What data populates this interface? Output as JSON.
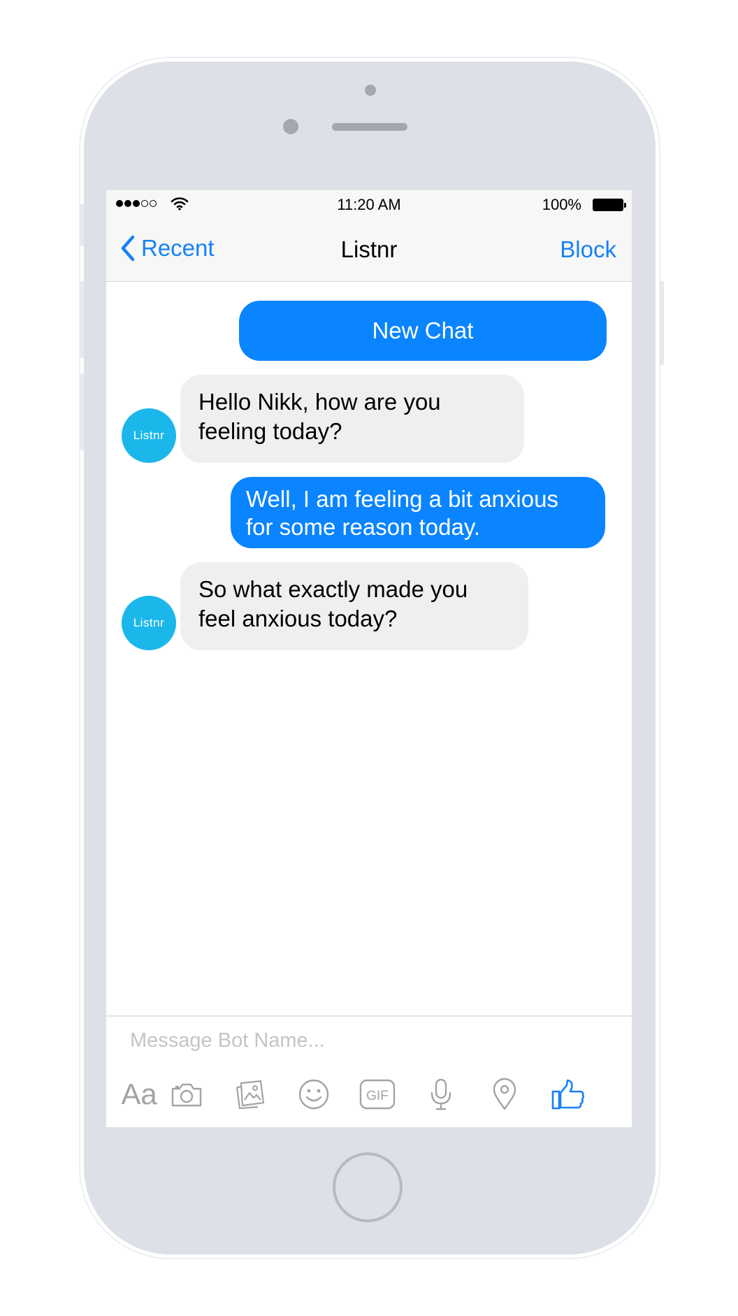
{
  "status_bar": {
    "time": "11:20 AM",
    "battery": "100%",
    "signal_bars_filled": 3,
    "signal_bars_total": 5
  },
  "nav": {
    "back_label": "Recent",
    "title": "Listnr",
    "block_label": "Block"
  },
  "chat": {
    "new_chat_label": "New Chat",
    "avatar_label": "Listnr",
    "messages": [
      {
        "sender": "bot",
        "text": "Hello Nikk, how are you feeling today?"
      },
      {
        "sender": "user",
        "text": "Well, I am feeling a bit anxious for some reason today."
      },
      {
        "sender": "bot",
        "text": "So what exactly made you feel anxious today?"
      }
    ]
  },
  "composer": {
    "placeholder": "Message Bot Name...",
    "tools": [
      {
        "name": "text-format",
        "label": "Aa"
      },
      {
        "name": "camera-icon"
      },
      {
        "name": "gallery-icon"
      },
      {
        "name": "emoji-icon"
      },
      {
        "name": "gif-icon",
        "label": "GIF"
      },
      {
        "name": "microphone-icon"
      },
      {
        "name": "location-icon"
      },
      {
        "name": "thumbs-up-icon"
      }
    ]
  },
  "colors": {
    "accent": "#1782f3",
    "user_bubble": "#0a84ff",
    "bot_bubble": "#efefef",
    "avatar": "#1cb7ea",
    "phone_body": "#dde0e7",
    "toolbar_icon": "#a3a3a8",
    "like_icon": "#1782f3"
  }
}
